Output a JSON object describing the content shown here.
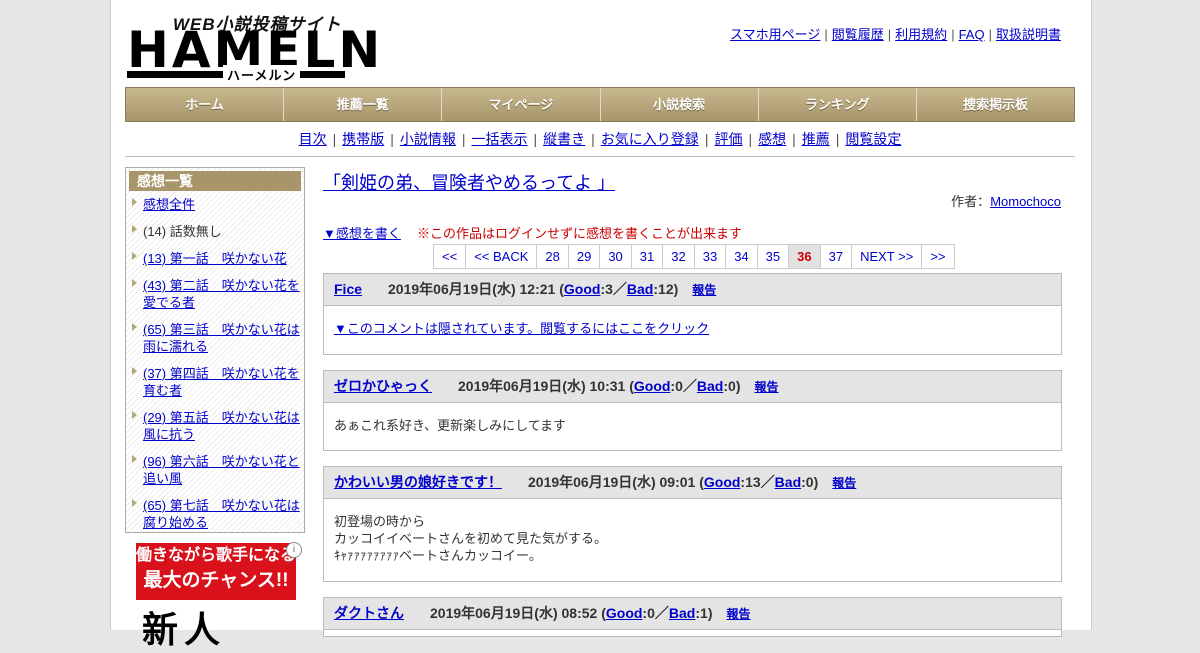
{
  "header": {
    "logo_sub": "WEB小説投稿サイト",
    "logo_main": "HAMELN",
    "logo_kana": "ハーメルン",
    "top_links": [
      "スマホ用ページ",
      "閲覧履歴",
      "利用規約",
      "FAQ",
      "取扱説明書"
    ]
  },
  "nav": [
    "ホーム",
    "推薦一覧",
    "マイページ",
    "小説検索",
    "ランキング",
    "捜索掲示板"
  ],
  "subnav": [
    "目次",
    "携帯版",
    "小説情報",
    "一括表示",
    "縦書き",
    "お気に入り登録",
    "評価",
    "感想",
    "推薦",
    "閲覧設定"
  ],
  "sidebar": {
    "title": "感想一覧",
    "items": [
      {
        "text": "感想全件",
        "link": true
      },
      {
        "text": "(14) 話数無し",
        "link": false
      },
      {
        "text": "(13) 第一話　咲かない花",
        "link": true
      },
      {
        "text": "(43) 第二話　咲かない花を愛でる者",
        "link": true
      },
      {
        "text": "(65) 第三話　咲かない花は雨に濡れる",
        "link": true
      },
      {
        "text": "(37) 第四話　咲かない花を育む者",
        "link": true
      },
      {
        "text": "(29) 第五話　咲かない花は風に抗う",
        "link": true
      },
      {
        "text": "(96) 第六話　咲かない花と追い風",
        "link": true
      },
      {
        "text": "(65) 第七話　咲かない花は腐り始める",
        "link": true
      }
    ]
  },
  "ad": {
    "line1": "働きながら歌手になる",
    "line2": "最大のチャンス!!",
    "big": "新人",
    "info": "i"
  },
  "main": {
    "title": "「剣姫の弟、冒険者やめるってよ 」",
    "author_label": "作者：",
    "author": "Momochoco",
    "write_link": "▼感想を書く",
    "notice": "※この作品はログインせずに感想を書くことが出来ます"
  },
  "pager": {
    "items": [
      "<<",
      "<< BACK",
      "28",
      "29",
      "30",
      "31",
      "32",
      "33",
      "34",
      "35",
      "36",
      "37",
      "NEXT >>",
      ">>"
    ],
    "current": "36"
  },
  "comments": [
    {
      "name": "Fice",
      "date": "2019年06月19日(水) 12:21",
      "good_label": "Good",
      "good": "3",
      "bad_label": "Bad",
      "bad": "12",
      "report": "報告",
      "hidden_link": "▼このコメントは隠されています。閲覧するにはここをクリック",
      "lines": []
    },
    {
      "name": "ゼロかひゃっく",
      "date": "2019年06月19日(水) 10:31",
      "good_label": "Good",
      "good": "0",
      "bad_label": "Bad",
      "bad": "0",
      "report": "報告",
      "hidden_link": "",
      "lines": [
        "あぁこれ系好き、更新楽しみにしてます"
      ]
    },
    {
      "name": "かわいい男の娘好きです！",
      "date": "2019年06月19日(水) 09:01",
      "good_label": "Good",
      "good": "13",
      "bad_label": "Bad",
      "bad": "0",
      "report": "報告",
      "hidden_link": "",
      "lines": [
        "初登場の時から",
        "カッコイイベートさんを初めて見た気がする。",
        "ｷｬｧｧｧｧｧｧｧｧベートさんカッコイー。"
      ]
    },
    {
      "name": "ダクトさん",
      "date": "2019年06月19日(水) 08:52",
      "good_label": "Good",
      "good": "0",
      "bad_label": "Bad",
      "bad": "1",
      "report": "報告",
      "hidden_link": "",
      "lines": []
    }
  ]
}
